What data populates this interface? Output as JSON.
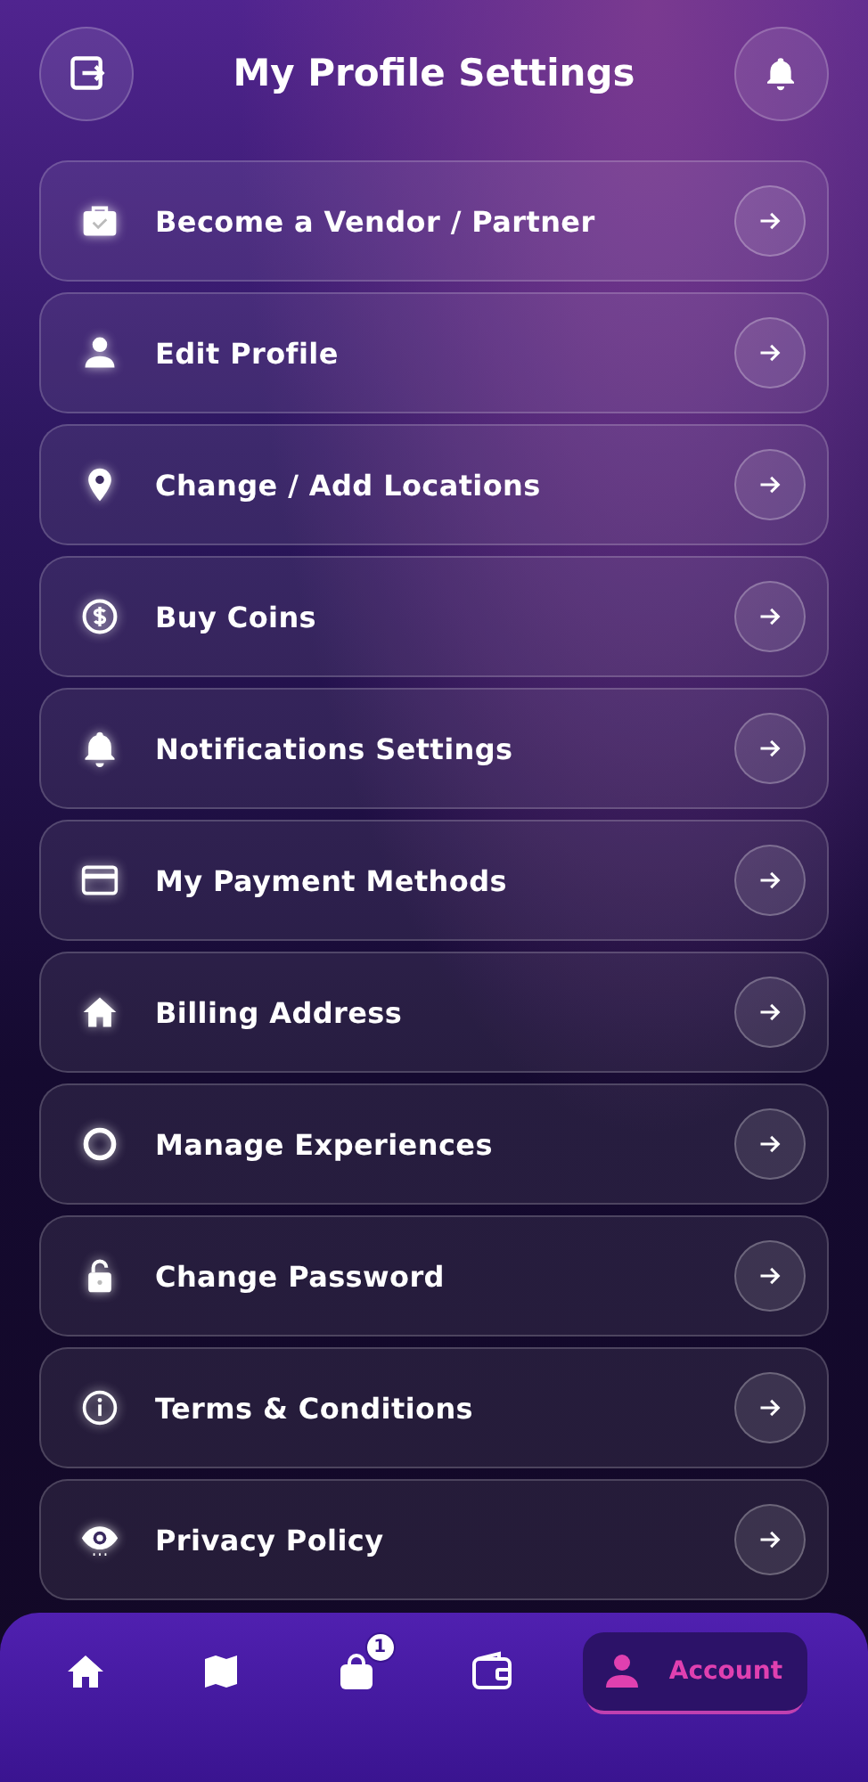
{
  "header": {
    "title": "My Profile Settings"
  },
  "menu": [
    {
      "label": "Become a Vendor / Partner",
      "kind": "briefcase"
    },
    {
      "label": "Edit Profile",
      "kind": "person"
    },
    {
      "label": "Change / Add Locations",
      "kind": "pin"
    },
    {
      "label": "Buy Coins",
      "kind": "coin"
    },
    {
      "label": "Notifications Settings",
      "kind": "bell"
    },
    {
      "label": "My Payment Methods",
      "kind": "card"
    },
    {
      "label": "Billing Address",
      "kind": "home"
    },
    {
      "label": "Manage Experiences",
      "kind": "ring"
    },
    {
      "label": "Change Password",
      "kind": "lock"
    },
    {
      "label": "Terms & Conditions",
      "kind": "info"
    },
    {
      "label": "Privacy Policy",
      "kind": "eye"
    }
  ],
  "nav": [
    {
      "kind": "home",
      "selected": false
    },
    {
      "kind": "map",
      "selected": false
    },
    {
      "kind": "bag",
      "selected": false,
      "badge": "1"
    },
    {
      "kind": "wallet",
      "selected": false
    },
    {
      "kind": "person",
      "selected": true,
      "label": "Account"
    }
  ]
}
